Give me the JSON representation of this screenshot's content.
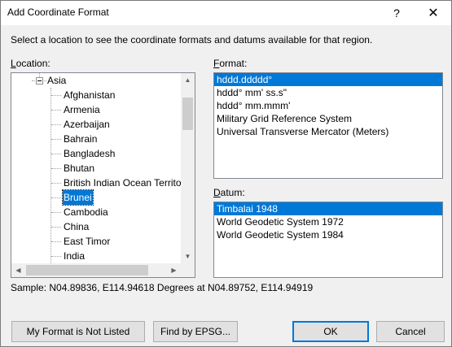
{
  "window": {
    "title": "Add Coordinate Format",
    "help_glyph": "?",
    "close_glyph": "✕"
  },
  "instruction": "Select a location to see the coordinate formats and datums available for that region.",
  "location": {
    "label_prefix": "L",
    "label_rest": "ocation:",
    "parent": "Asia",
    "items": [
      "Afghanistan",
      "Armenia",
      "Azerbaijan",
      "Bahrain",
      "Bangladesh",
      "Bhutan",
      "British Indian Ocean Territor",
      "Brunei",
      "Cambodia",
      "China",
      "East Timor",
      "India"
    ],
    "selected": "Brunei"
  },
  "format": {
    "label_prefix": "F",
    "label_rest": "ormat:",
    "items": [
      "hddd.ddddd°",
      "hddd° mm' ss.s\"",
      "hddd° mm.mmm'",
      "Military Grid Reference System",
      "Universal Transverse Mercator (Meters)"
    ],
    "selected": "hddd.ddddd°"
  },
  "datum": {
    "label_prefix": "D",
    "label_rest": "atum:",
    "items": [
      "Timbalai 1948",
      "World Geodetic System 1972",
      "World Geodetic System 1984"
    ],
    "selected": "Timbalai 1948"
  },
  "sample": "Sample: N04.89836, E114.94618 Degrees at N04.89752, E114.94919",
  "buttons": {
    "not_listed": "My Format is Not Listed",
    "find_epsg": "Find by EPSG...",
    "ok": "OK",
    "cancel": "Cancel"
  },
  "colors": {
    "selection": "#0078d7",
    "dialog_bg": "#f0f0f0",
    "button_bg": "#e1e1e1"
  },
  "icons": {
    "expander": "minus-box-icon",
    "scroll_up": "arrow-up-icon",
    "scroll_down": "arrow-down-icon",
    "scroll_left": "arrow-left-icon",
    "scroll_right": "arrow-right-icon"
  }
}
